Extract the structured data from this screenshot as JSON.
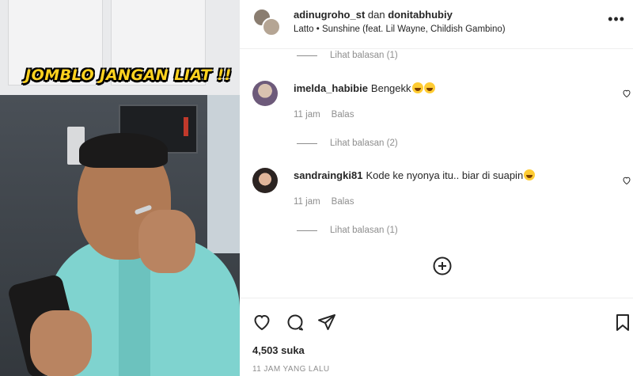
{
  "video": {
    "overlay_text": "JOMBLO JANGAN LIAT !!"
  },
  "header": {
    "user1": "adinugroho_st",
    "connector": "dan",
    "user2": "donitabhubiy",
    "song": "Latto • Sunshine (feat. Lil Wayne, Childish Gambino)",
    "more_icon": "more-horizontal-icon"
  },
  "thread": {
    "replies_top": "Lihat balasan (1)",
    "comments": [
      {
        "user": "imelda_habibie",
        "text": "Bengekk",
        "emoji": "laughing-tears-emoji",
        "time": "11 jam",
        "reply": "Balas",
        "replies": "Lihat balasan (2)"
      },
      {
        "user": "sandraingki81",
        "text": "Kode ke nyonya itu.. biar di suapin",
        "emoji": "laughing-tears-emoji",
        "time": "11 jam",
        "reply": "Balas",
        "replies": "Lihat balasan (1)"
      }
    ],
    "load_more_icon": "plus-circle-icon"
  },
  "actions": {
    "icons": [
      "heart-icon",
      "comment-icon",
      "share-icon",
      "bookmark-icon"
    ],
    "likes": "4,503 suka",
    "timestamp": "11 JAM YANG LALU"
  },
  "colors": {
    "text": "#262626",
    "secondary": "#8e8e8e",
    "overlay_yellow": "#ffd21f"
  }
}
